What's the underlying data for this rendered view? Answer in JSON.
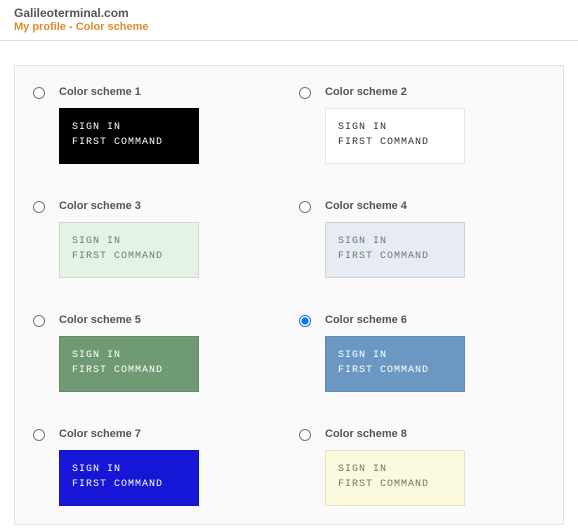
{
  "header": {
    "site_title": "Galileoterminal.com",
    "page_subtitle": "My profile - Color scheme"
  },
  "sample": {
    "line1": "SIGN IN",
    "line2": "FIRST COMMAND"
  },
  "schemes": [
    {
      "id": 1,
      "label": "Color scheme 1",
      "bg": "#000000",
      "fg": "#ffffff",
      "selected": false
    },
    {
      "id": 2,
      "label": "Color scheme 2",
      "bg": "#ffffff",
      "fg": "#333333",
      "selected": false
    },
    {
      "id": 3,
      "label": "Color scheme 3",
      "bg": "#e4f3e4",
      "fg": "#6b7f6b",
      "selected": false
    },
    {
      "id": 4,
      "label": "Color scheme 4",
      "bg": "#e6ecf1",
      "fg": "#6b7785",
      "selected": false
    },
    {
      "id": 5,
      "label": "Color scheme 5",
      "bg": "#6f9a74",
      "fg": "#ffffff",
      "selected": false
    },
    {
      "id": 6,
      "label": "Color scheme 6",
      "bg": "#6a98c3",
      "fg": "#ffffff",
      "selected": true
    },
    {
      "id": 7,
      "label": "Color scheme 7",
      "bg": "#1616d6",
      "fg": "#ffffff",
      "selected": false
    },
    {
      "id": 8,
      "label": "Color scheme 8",
      "bg": "#fcfadd",
      "fg": "#787654",
      "selected": false
    }
  ]
}
